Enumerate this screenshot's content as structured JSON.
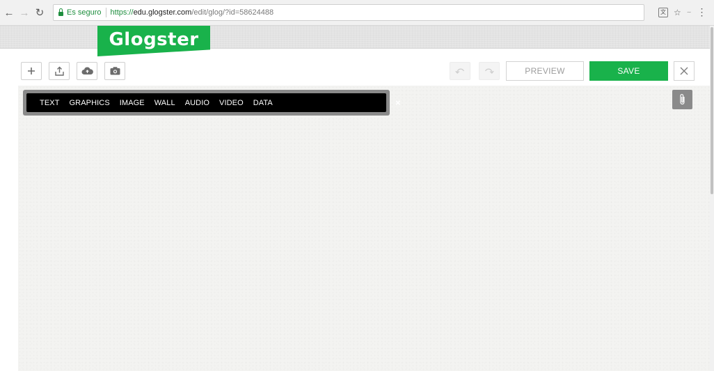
{
  "browser": {
    "secure_label": "Es seguro",
    "url_scheme": "https://",
    "url_host": "edu.glogster.com",
    "url_path": "/edit/glog/?id=58624488"
  },
  "app": {
    "logo_text": "Glogster",
    "brand_color": "#19b24b"
  },
  "toolbar": {
    "buttons": [
      {
        "name": "add",
        "icon": "plus-icon"
      },
      {
        "name": "upload",
        "icon": "upload-icon"
      },
      {
        "name": "cloud",
        "icon": "cloud-icon"
      },
      {
        "name": "camera",
        "icon": "camera-icon"
      }
    ],
    "preview_label": "PREVIEW",
    "save_label": "SAVE"
  },
  "insert_menu": {
    "items": [
      "TEXT",
      "GRAPHICS",
      "IMAGE",
      "WALL",
      "AUDIO",
      "VIDEO",
      "DATA"
    ],
    "close_label": "×"
  }
}
